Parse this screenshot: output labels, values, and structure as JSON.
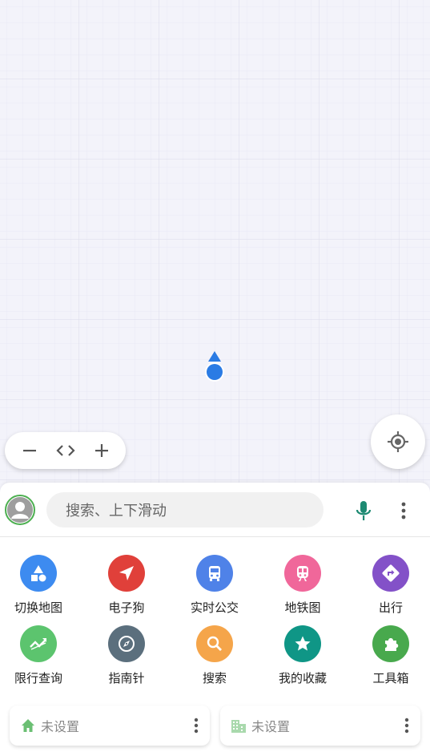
{
  "map": {
    "zoom_out_symbol": "−",
    "zoom_in_symbol": "+",
    "zoom_slider_symbol": "<>"
  },
  "search": {
    "placeholder": "搜索、上下滑动"
  },
  "tools": [
    {
      "label": "切换地图",
      "icon": "shapes-icon",
      "color": "#3d8bf0"
    },
    {
      "label": "电子狗",
      "icon": "navigation-arrow-icon",
      "color": "#e0403a"
    },
    {
      "label": "实时公交",
      "icon": "bus-icon",
      "color": "#4f82e8"
    },
    {
      "label": "地铁图",
      "icon": "subway-icon",
      "color": "#f0679a"
    },
    {
      "label": "出行",
      "icon": "directions-icon",
      "color": "#8351c8"
    },
    {
      "label": "限行查询",
      "icon": "trend-icon",
      "color": "#5cc46e"
    },
    {
      "label": "指南针",
      "icon": "compass-icon",
      "color": "#5b6f7d"
    },
    {
      "label": "搜索",
      "icon": "search-icon",
      "color": "#f5a54a"
    },
    {
      "label": "我的收藏",
      "icon": "star-icon",
      "color": "#0f9686"
    },
    {
      "label": "工具箱",
      "icon": "puzzle-icon",
      "color": "#48a94d"
    }
  ],
  "home": {
    "label": "未设置",
    "icon": "home-icon"
  },
  "work": {
    "label": "未设置",
    "icon": "building-icon"
  },
  "colors": {
    "accent_green": "#4caf50",
    "mic_green": "#1d8a72",
    "marker_blue": "#2a7be4"
  }
}
